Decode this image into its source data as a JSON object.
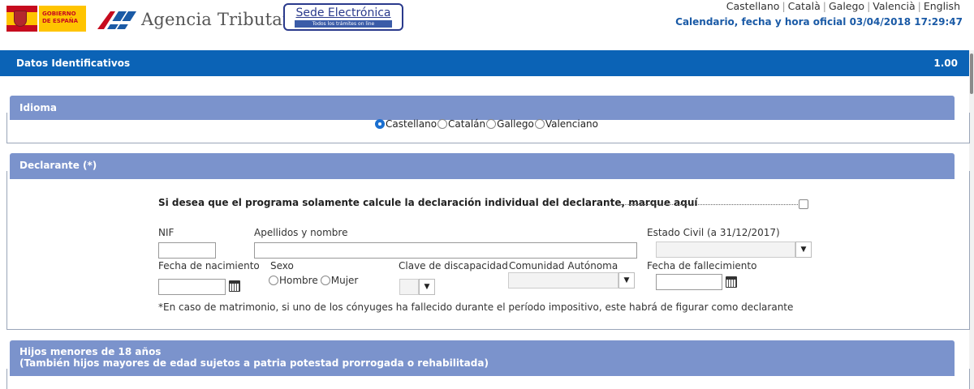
{
  "header": {
    "gov_text": "GOBIERNO DE ESPAÑA",
    "agency_title": "Agencia Tributaria",
    "sede_main": "Sede Electrónica",
    "sede_sub": "Todos los trámites on line",
    "languages": [
      "Castellano",
      "Català",
      "Galego",
      "Valencià",
      "English"
    ],
    "calendar_link": "Calendario, fecha y hora oficial 03/04/2018 17:29:47"
  },
  "main_bar": {
    "label": "Datos Identificativos",
    "version": "1.00"
  },
  "idioma": {
    "title": "Idioma",
    "options": [
      "Castellano",
      "Catalán",
      "Gallego",
      "Valenciano"
    ],
    "selected": "Castellano"
  },
  "declarante": {
    "title": "Declarante (*)",
    "individual_text": "Si desea que el programa solamente calcule la declaración individual del declarante, marque aquí",
    "nif_label": "NIF",
    "nif_value": "",
    "apellidos_label": "Apellidos y nombre",
    "apellidos_value": "",
    "estado_civil_label": "Estado Civil (a 31/12/2017)",
    "fecha_nac_label": "Fecha de nacimiento",
    "sexo_label": "Sexo",
    "sexo_options": [
      "Hombre",
      "Mujer"
    ],
    "discapacidad_label": "Clave de discapacidad",
    "comunidad_label": "Comunidad Autónoma",
    "fallecimiento_label": "Fecha de fallecimiento",
    "note": "*En caso de matrimonio, si uno de los cónyuges ha fallecido durante el período impositivo, este habrá de figurar como declarante"
  },
  "hijos": {
    "title_line1": "Hijos menores de 18 años",
    "title_line2": "(También hijos mayores de edad sujetos a patria potestad prorrogada o rehabilitada)"
  },
  "colors": {
    "main_bar": "#0b63b6",
    "section_header": "#7b93cc",
    "link_blue": "#1a5aa6"
  },
  "icons": [
    "gobierno-logo",
    "aeat-logo",
    "calendar-icon",
    "chevron-down-icon"
  ]
}
